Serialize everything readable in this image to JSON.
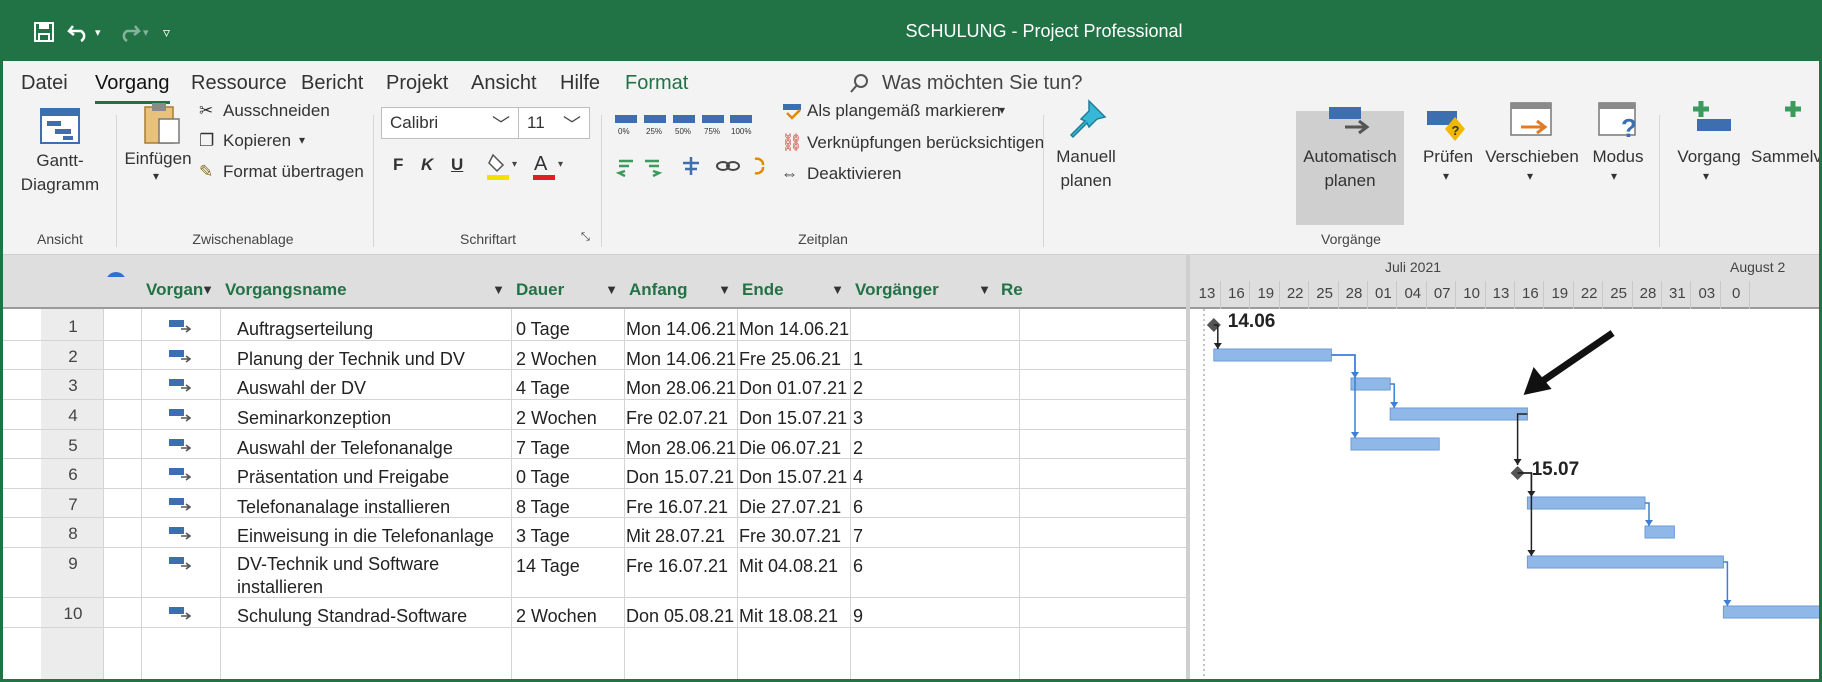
{
  "window": {
    "title": "SCHULUNG  -  Project Professional",
    "colors": {
      "accent": "#217346",
      "bar": "#8fb8e8",
      "link": "#3d7fd4"
    }
  },
  "menu": {
    "tabs": [
      "Datei",
      "Vorgang",
      "Ressource",
      "Bericht",
      "Projekt",
      "Ansicht",
      "Hilfe",
      "Format"
    ],
    "active_tab": "Vorgang",
    "tell_me": "Was möchten Sie tun?"
  },
  "ribbon": {
    "ansicht": {
      "button": "Gantt-\nDiagramm",
      "group": "Ansicht"
    },
    "zwischenablage": {
      "paste": "Einfügen",
      "cut": "Ausschneiden",
      "copy": "Kopieren",
      "format_painter": "Format übertragen",
      "group": "Zwischenablage"
    },
    "schriftart": {
      "font": "Calibri",
      "size": "11",
      "bold": "F",
      "italic": "K",
      "underline": "U",
      "font_color_letter": "A",
      "group": "Schriftart"
    },
    "zeitplan": {
      "pct": [
        "0%",
        "25%",
        "50%",
        "75%",
        "100%"
      ],
      "mark_on_track": "Als plangemäß markieren",
      "respect_links": "Verknüpfungen berücksichtigen",
      "inactivate": "Deaktivieren",
      "group": "Zeitplan"
    },
    "vorgaenge": {
      "manual": "Manuell\nplanen",
      "auto": "Automatisch\nplanen",
      "inspect": "Prüfen",
      "move": "Verschieben",
      "mode": "Modus",
      "group": "Vorgänge"
    },
    "insert": {
      "task": "Vorgang",
      "summary": "Sammelv"
    }
  },
  "grid": {
    "headers": {
      "info": "i",
      "mode": "Vorgan",
      "name": "Vorgangsname",
      "duration": "Dauer",
      "start": "Anfang",
      "finish": "Ende",
      "pred": "Vorgänger",
      "res": "Re"
    },
    "rows": [
      {
        "id": "1",
        "name": "Auftragserteilung",
        "duration": "0 Tage",
        "start": "Mon 14.06.21",
        "finish": "Mon 14.06.21",
        "pred": ""
      },
      {
        "id": "2",
        "name": "Planung der Technik und DV",
        "duration": "2 Wochen",
        "start": "Mon 14.06.21",
        "finish": "Fre 25.06.21",
        "pred": "1"
      },
      {
        "id": "3",
        "name": "Auswahl der DV",
        "duration": "4 Tage",
        "start": "Mon 28.06.21",
        "finish": "Don 01.07.21",
        "pred": "2"
      },
      {
        "id": "4",
        "name": "Seminarkonzeption",
        "duration": "2 Wochen",
        "start": "Fre 02.07.21",
        "finish": "Don 15.07.21",
        "pred": "3"
      },
      {
        "id": "5",
        "name": "Auswahl der Telefonanalge",
        "duration": "7 Tage",
        "start": "Mon 28.06.21",
        "finish": "Die 06.07.21",
        "pred": "2"
      },
      {
        "id": "6",
        "name": "Präsentation und Freigabe",
        "duration": "0 Tage",
        "start": "Don 15.07.21",
        "finish": "Don 15.07.21",
        "pred": "4"
      },
      {
        "id": "7",
        "name": "Telefonanalage installieren",
        "duration": "8 Tage",
        "start": "Fre 16.07.21",
        "finish": "Die 27.07.21",
        "pred": "6"
      },
      {
        "id": "8",
        "name": "Einweisung in die Telefonanlage",
        "duration": "3 Tage",
        "start": "Mit 28.07.21",
        "finish": "Fre 30.07.21",
        "pred": "7"
      },
      {
        "id": "9",
        "name": "DV-Technik und Software",
        "name2": "installieren",
        "duration": "14 Tage",
        "start": "Fre 16.07.21",
        "finish": "Mit 04.08.21",
        "pred": "6"
      },
      {
        "id": "10",
        "name": "Schulung Standrad-Software",
        "duration": "2 Wochen",
        "start": "Don 05.08.21",
        "finish": "Mit 18.08.21",
        "pred": "9"
      }
    ]
  },
  "gantt": {
    "months": [
      "Juli 2021",
      "August 2"
    ],
    "days": [
      "13",
      "16",
      "19",
      "22",
      "25",
      "28",
      "01",
      "04",
      "07",
      "10",
      "13",
      "16",
      "19",
      "22",
      "25",
      "28",
      "31",
      "03",
      "0"
    ],
    "milestones": [
      "14.06",
      "15.07"
    ]
  }
}
